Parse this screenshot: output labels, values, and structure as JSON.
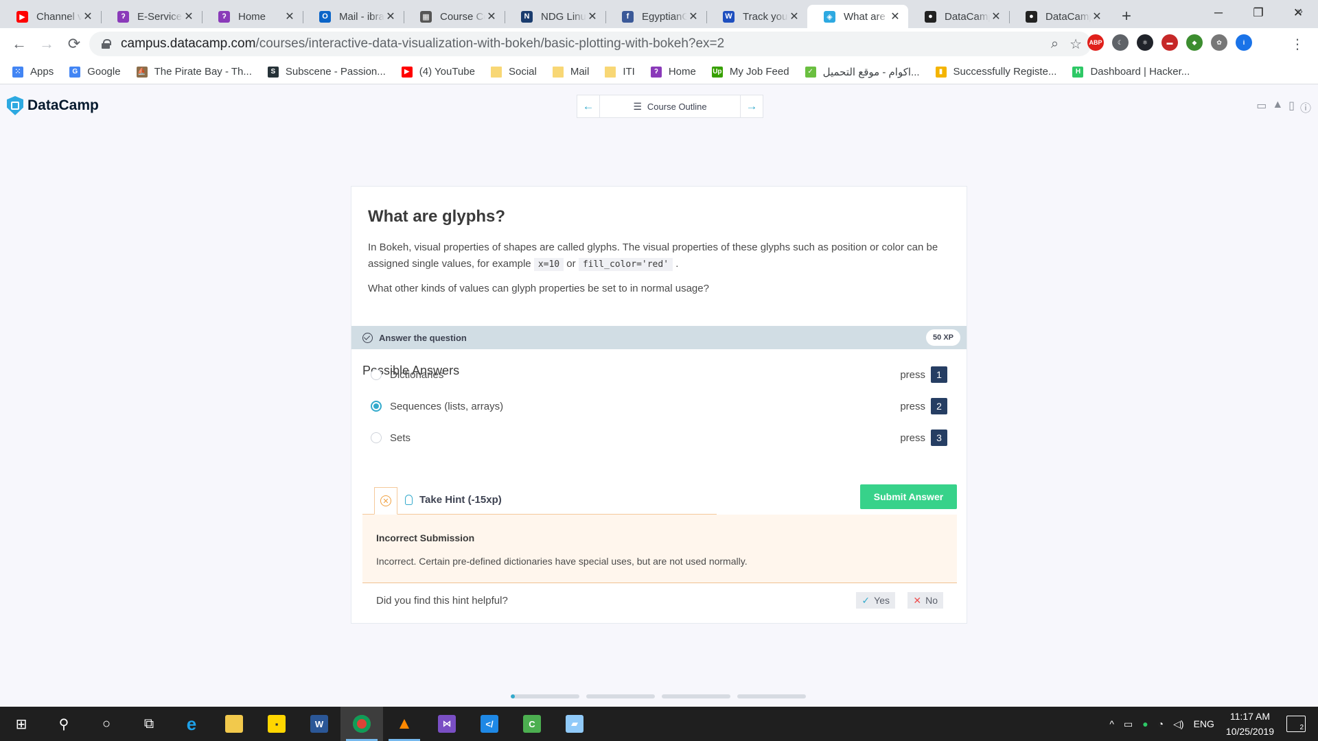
{
  "browser": {
    "tabs": [
      {
        "title": "Channel videos",
        "favicon": "youtube-icon",
        "color": "#ff0000",
        "glyph": "▶",
        "active": false
      },
      {
        "title": "E-Services",
        "favicon": "e-services-icon",
        "color": "#8a3ab9",
        "glyph": "ʔ",
        "active": false
      },
      {
        "title": "Home",
        "favicon": "home-icon",
        "color": "#8a3ab9",
        "glyph": "ʔ",
        "active": false
      },
      {
        "title": "Mail - ibrahim",
        "favicon": "outlook-icon",
        "color": "#0a64c8",
        "glyph": "O",
        "active": false
      },
      {
        "title": "Course Content",
        "favicon": "course-icon",
        "color": "#555555",
        "glyph": "▦",
        "active": false
      },
      {
        "title": "NDG Linux",
        "favicon": "ndg-icon",
        "color": "#1a3c6e",
        "glyph": "N",
        "active": false
      },
      {
        "title": "EgyptianGeeks",
        "favicon": "facebook-icon",
        "color": "#3b5998",
        "glyph": "f",
        "active": false
      },
      {
        "title": "Track your",
        "favicon": "w-icon",
        "color": "#1e4fbf",
        "glyph": "W",
        "active": false
      },
      {
        "title": "What are glyphs",
        "favicon": "datacamp-icon",
        "color": "#2da9e1",
        "glyph": "◈",
        "active": true
      },
      {
        "title": "DataCamp",
        "favicon": "github-icon",
        "color": "#222222",
        "glyph": "●",
        "active": false
      },
      {
        "title": "DataCamp",
        "favicon": "github-icon",
        "color": "#222222",
        "glyph": "●",
        "active": false
      }
    ],
    "url_host": "campus.datacamp.com",
    "url_path": "/courses/interactive-data-visualization-with-bokeh/basic-plotting-with-bokeh?ex=2",
    "extensions": [
      {
        "name": "abp-icon",
        "label": "ABP",
        "color": "#e0201b"
      },
      {
        "name": "dark-mode-icon",
        "label": "☾",
        "color": "#5f6368"
      },
      {
        "name": "react-devtools-icon",
        "label": "⚛",
        "color": "#20232a"
      },
      {
        "name": "pdf-ext-icon",
        "label": "▬",
        "color": "#c62828"
      },
      {
        "name": "globe-ext-icon",
        "label": "◆",
        "color": "#3c8d2f"
      },
      {
        "name": "film-ext-icon",
        "label": "✿",
        "color": "#777777"
      },
      {
        "name": "profile-avatar-icon",
        "label": "i",
        "color": "#1a73e8"
      }
    ]
  },
  "bookmarks": [
    {
      "label": "Apps",
      "icon": "apps-grid-icon",
      "color": "#4285f4",
      "glyph": "⁙"
    },
    {
      "label": "Google",
      "icon": "google-icon",
      "color": "#4285f4",
      "glyph": "G"
    },
    {
      "label": "The Pirate Bay - Th...",
      "icon": "pirate-ship-icon",
      "color": "#8d6e4a",
      "glyph": "⛵"
    },
    {
      "label": "Subscene - Passion...",
      "icon": "subscene-icon",
      "color": "#263238",
      "glyph": "S"
    },
    {
      "label": "(4) YouTube",
      "icon": "youtube-icon",
      "color": "#ff0000",
      "glyph": "▶"
    },
    {
      "label": "Social",
      "icon": "folder-icon",
      "color": "#f8d775",
      "glyph": ""
    },
    {
      "label": "Mail",
      "icon": "folder-icon",
      "color": "#f8d775",
      "glyph": ""
    },
    {
      "label": "ITI",
      "icon": "folder-icon",
      "color": "#f8d775",
      "glyph": ""
    },
    {
      "label": "Home",
      "icon": "home-icon",
      "color": "#8a3ab9",
      "glyph": "ʔ"
    },
    {
      "label": "My Job Feed",
      "icon": "upwork-icon",
      "color": "#37a000",
      "glyph": "Up"
    },
    {
      "label": "اكوام - موقع التحميل...",
      "icon": "akwam-icon",
      "color": "#6abf40",
      "glyph": "✓"
    },
    {
      "label": "Successfully Registe...",
      "icon": "bar-chart-icon",
      "color": "#f4b400",
      "glyph": "▮"
    },
    {
      "label": "Dashboard | Hacker...",
      "icon": "hackerrank-icon",
      "color": "#2ec866",
      "glyph": "H"
    }
  ],
  "datacamp": {
    "brand": "DataCamp",
    "course_outline": "Course Outline"
  },
  "exercise": {
    "title": "What are glyphs?",
    "desc_part1": "In Bokeh, visual properties of shapes are called glyphs. The visual properties of these glyphs such as position or color can be assigned single values, for example",
    "code1": "x=10",
    "desc_or": "or",
    "code2": "fill_color='red'",
    "desc_end": ".",
    "question": "What other kinds of values can glyph properties be set to in normal usage?",
    "answer_bar": "Answer the question",
    "xp": "50 XP",
    "possible_answers": "Possible Answers",
    "press_label": "press",
    "options": [
      {
        "label": "Dictionaries",
        "key": "1",
        "selected": false
      },
      {
        "label": "Sequences (lists, arrays)",
        "key": "2",
        "selected": true
      },
      {
        "label": "Sets",
        "key": "3",
        "selected": false
      }
    ],
    "take_hint": "Take Hint (-15xp)",
    "submit": "Submit Answer",
    "feedback_title": "Incorrect Submission",
    "feedback_message": "Incorrect. Certain pre-defined dictionaries have special uses, but are not used normally.",
    "helpful_question": "Did you find this hint helpful?",
    "yes": "Yes",
    "no": "No"
  },
  "taskbar": {
    "language": "ENG",
    "time": "11:17 AM",
    "date": "10/25/2019",
    "notifications": "2"
  }
}
